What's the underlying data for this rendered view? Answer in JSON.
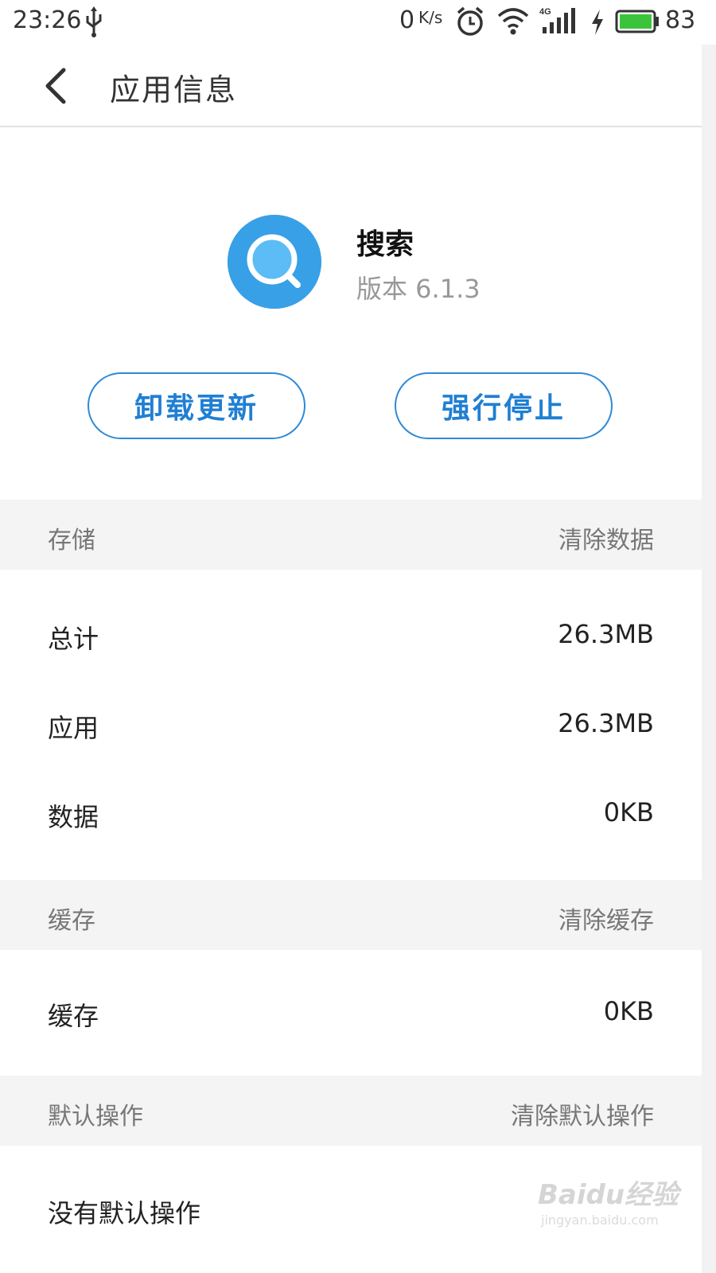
{
  "status_bar": {
    "time": "23:26",
    "net_speed": "0",
    "net_speed_unit": "K/s",
    "network_type": "4G",
    "battery": "83",
    "icons": [
      "usb-icon",
      "alarm-icon",
      "wifi-icon",
      "signal-icon",
      "charging-icon",
      "battery-icon"
    ]
  },
  "header": {
    "title": "应用信息",
    "back_icon": "chevron-left-icon"
  },
  "app": {
    "name": "搜索",
    "version": "版本 6.1.3",
    "icon": "search-icon",
    "icon_color": "#37a0e6"
  },
  "actions": {
    "uninstall_updates": "卸载更新",
    "force_stop": "强行停止",
    "accent_color": "#1f7fd3"
  },
  "storage": {
    "title": "存储",
    "action": "清除数据",
    "rows": [
      {
        "label": "总计",
        "value": "26.3MB"
      },
      {
        "label": "应用",
        "value": "26.3MB"
      },
      {
        "label": "数据",
        "value": "0KB"
      }
    ]
  },
  "cache": {
    "title": "缓存",
    "action": "清除缓存",
    "rows": [
      {
        "label": "缓存",
        "value": "0KB"
      }
    ]
  },
  "defaults": {
    "title": "默认操作",
    "action": "清除默认操作",
    "rows": [
      {
        "label": "没有默认操作"
      }
    ]
  },
  "watermark": {
    "logo": "Baidu经验",
    "site": "jingyan.baidu.com"
  }
}
